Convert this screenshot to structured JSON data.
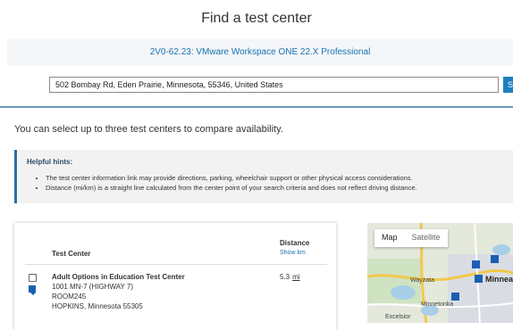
{
  "header": {
    "title": "Find a test center"
  },
  "exam": {
    "name": "2V0-62.23: VMware Workspace ONE 22.X Professional"
  },
  "search": {
    "value": "502 Bombay Rd, Eden Prairie, Minnesota, 55346, United States",
    "button_label": "S"
  },
  "compare_text": "You can select up to three test centers to compare availability.",
  "hints": {
    "title": "Helpful hints:",
    "items": [
      "The test center information link may provide directions, parking, wheelchair support or other physical access considerations.",
      "Distance (mi/km) is a straight line calculated from the center point of your search criteria and does not reflect driving distance."
    ]
  },
  "results": {
    "col_test_center": "Test Center",
    "col_distance": "Distance",
    "show_km_label": "Show km",
    "rows": [
      {
        "name": "Adult Options in Education Test Center",
        "address1": "1001 MN-7 (HIGHWAY 7)",
        "address2": "ROOM245",
        "city": "HOPKINS, Minnesota 55305",
        "distance": "5.3",
        "unit": "mi",
        "marker": "1"
      }
    ]
  },
  "map": {
    "tab_map": "Map",
    "tab_satellite": "Satellite",
    "labels": {
      "wayzata": "Wayzata",
      "minnea": "Minnea",
      "minnetonka": "Minnetonka",
      "excelsior": "Excelsior"
    },
    "pins": [
      "1",
      "2",
      "3",
      "4"
    ]
  }
}
